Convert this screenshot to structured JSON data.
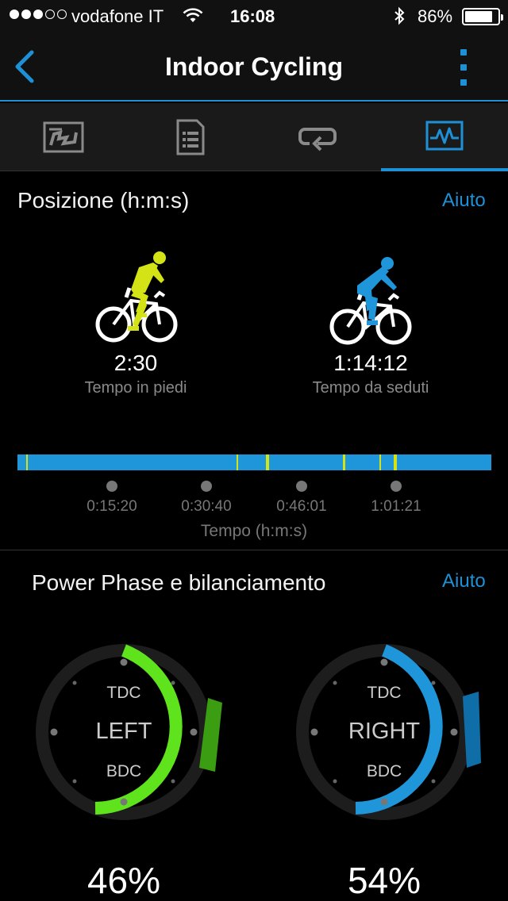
{
  "status_bar": {
    "carrier": "vodafone IT",
    "time": "16:08",
    "battery_percent": "86%",
    "battery_level": 0.86,
    "signal_bars_filled": 3,
    "signal_bars_total": 5
  },
  "nav": {
    "title": "Indoor Cycling",
    "back_icon": "chevron-left-icon",
    "more_icon": "vertical-ellipsis-icon"
  },
  "tabs": [
    {
      "icon": "map-icon",
      "active": false
    },
    {
      "icon": "document-list-icon",
      "active": false
    },
    {
      "icon": "laps-loop-icon",
      "active": false
    },
    {
      "icon": "chart-activity-icon",
      "active": true
    }
  ],
  "position_section": {
    "title": "Posizione (h:m:s)",
    "help": "Aiuto",
    "standing": {
      "value": "2:30",
      "label": "Tempo in piedi",
      "color": "#d4e316"
    },
    "seated": {
      "value": "1:14:12",
      "label": "Tempo da seduti",
      "color": "#1f96d9"
    },
    "timeline": {
      "ticks": [
        "0:15:20",
        "0:30:40",
        "0:46:01",
        "1:01:21"
      ],
      "axis_label": "Tempo (h:m:s)"
    }
  },
  "power_section": {
    "title": "Power Phase e bilanciamento",
    "help": "Aiuto",
    "left": {
      "top": "TDC",
      "center": "LEFT",
      "bottom": "BDC",
      "percent": "46%",
      "color": "#5ee31d",
      "peak_color": "#3a9d12"
    },
    "right": {
      "top": "TDC",
      "center": "RIGHT",
      "bottom": "BDC",
      "percent": "54%",
      "color": "#1f96d9",
      "peak_color": "#0f6ea8"
    }
  }
}
